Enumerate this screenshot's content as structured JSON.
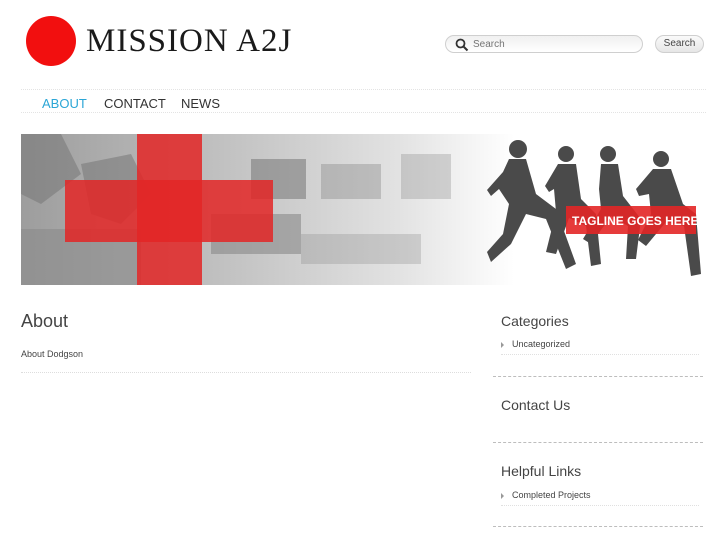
{
  "site": {
    "logo_text": "MISSION A2J",
    "logo_color": "#f20f0f"
  },
  "search": {
    "placeholder": "Search",
    "button_label": "Search"
  },
  "nav": {
    "active_color": "#2ba6d6",
    "items": [
      {
        "label": "ABOUT",
        "active": true
      },
      {
        "label": "CONTACT",
        "active": false
      },
      {
        "label": "NEWS",
        "active": false
      }
    ]
  },
  "banner": {
    "tagline": "TAGLINE GOES HERE"
  },
  "main": {
    "title": "About",
    "body": "About Dodgson"
  },
  "sidebar": {
    "categories": {
      "title": "Categories",
      "items": [
        "Uncategorized"
      ]
    },
    "contact": {
      "title": "Contact Us"
    },
    "links": {
      "title": "Helpful Links",
      "items": [
        "Completed Projects"
      ]
    }
  }
}
